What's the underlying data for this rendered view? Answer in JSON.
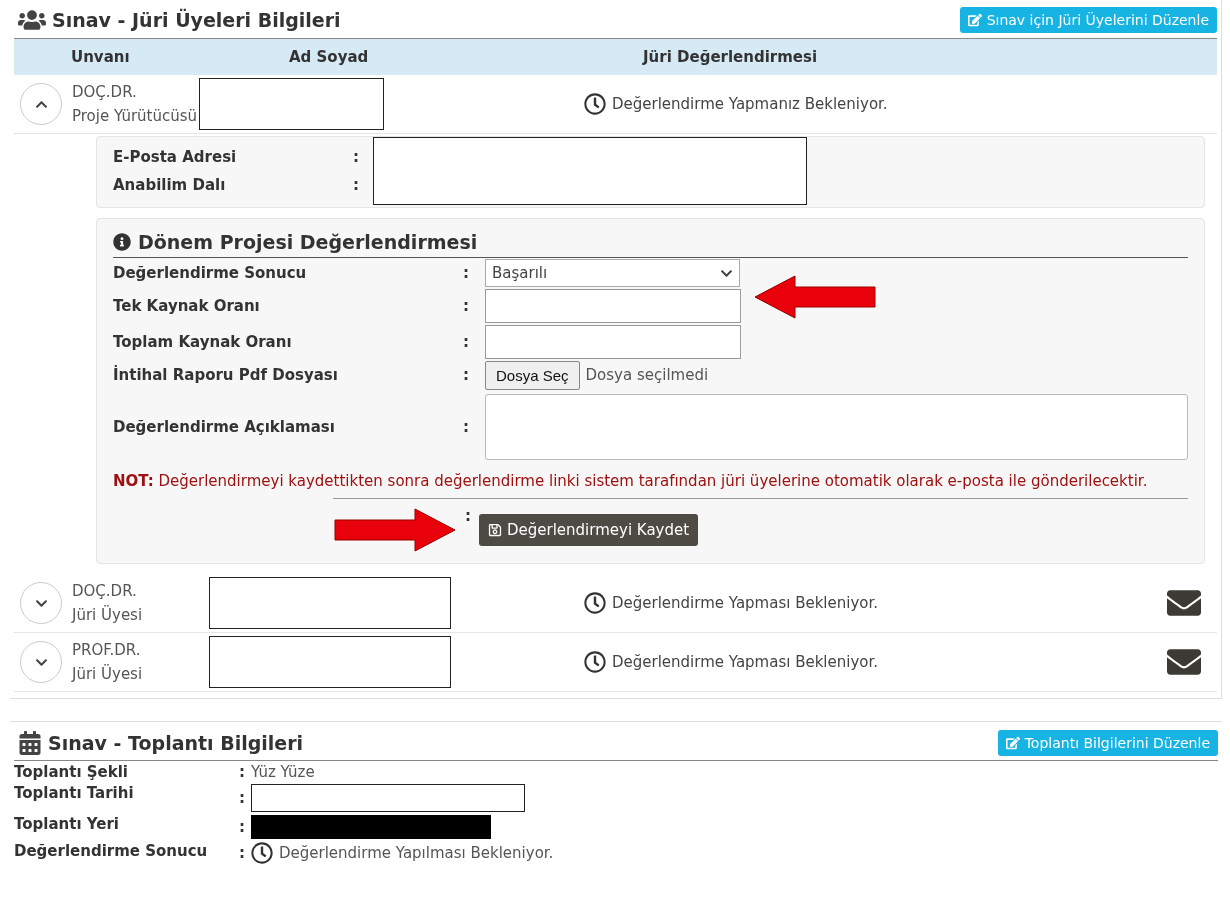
{
  "section_title": "Sınav - Jüri Üyeleri Bilgileri",
  "edit_button": "Sınav için Jüri Üyelerini Düzenle",
  "columns": [
    "Unvanı",
    "Ad Soyad",
    "Jüri Değerlendirmesi"
  ],
  "members": [
    {
      "title": "DOÇ.DR.",
      "role": "Proje Yürütücüsü",
      "status": "Değerlendirme Yapmanız Bekleniyor.",
      "expanded": true,
      "mail_button": false
    },
    {
      "title": "DOÇ.DR.",
      "role": "Jüri Üyesi",
      "status": "Değerlendirme Yapması Bekleniyor.",
      "expanded": false,
      "mail_button": true
    },
    {
      "title": "PROF.DR.",
      "role": "Jüri Üyesi",
      "status": "Değerlendirme Yapması Bekleniyor.",
      "expanded": false,
      "mail_button": true
    }
  ],
  "details": [
    {
      "label": "E-Posta Adresi",
      "separator": ":"
    },
    {
      "label": "Anabilim Dalı",
      "separator": ":"
    }
  ],
  "evaluation": {
    "title": "Dönem Projesi Değerlendirmesi",
    "fields": [
      {
        "kind": "select",
        "label": "Değerlendirme Sonucu",
        "separator": ":",
        "value": "Başarılı"
      },
      {
        "kind": "input",
        "label": "Tek Kaynak Oranı",
        "separator": ":"
      },
      {
        "kind": "input",
        "label": "Toplam Kaynak Oranı",
        "separator": ":"
      },
      {
        "kind": "file",
        "label": "İntihal Raporu Pdf Dosyası",
        "separator": ":",
        "button": "Dosya Seç",
        "status": "Dosya seçilmedi"
      },
      {
        "kind": "textarea",
        "label": "Değerlendirme Açıklaması",
        "separator": ":"
      }
    ],
    "note": "**NOT:** Değerlendirmeyi kaydettikten sonra değerlendirme linki sistem tarafından jüri üyelerine otomatik olarak e-posta ile gönderilecektir.",
    "save_separator": ":",
    "save_button": "Değerlendirmeyi Kaydet"
  },
  "meeting": {
    "title": "Sınav - Toplantı Bilgileri",
    "edit_button": "Toplantı Bilgilerini Düzenle",
    "fields": [
      {
        "kind": "text",
        "label": "Toplantı Şekli",
        "separator": ":",
        "value": "Yüz Yüze"
      },
      {
        "kind": "blank",
        "label": "Toplantı Tarihi",
        "separator": ":"
      },
      {
        "kind": "redacted",
        "label": "Toplantı Yeri",
        "separator": ":"
      },
      {
        "kind": "status",
        "label": "Değerlendirme Sonucu",
        "separator": ":",
        "value": "Değerlendirme Yapılması Bekleniyor."
      }
    ]
  }
}
